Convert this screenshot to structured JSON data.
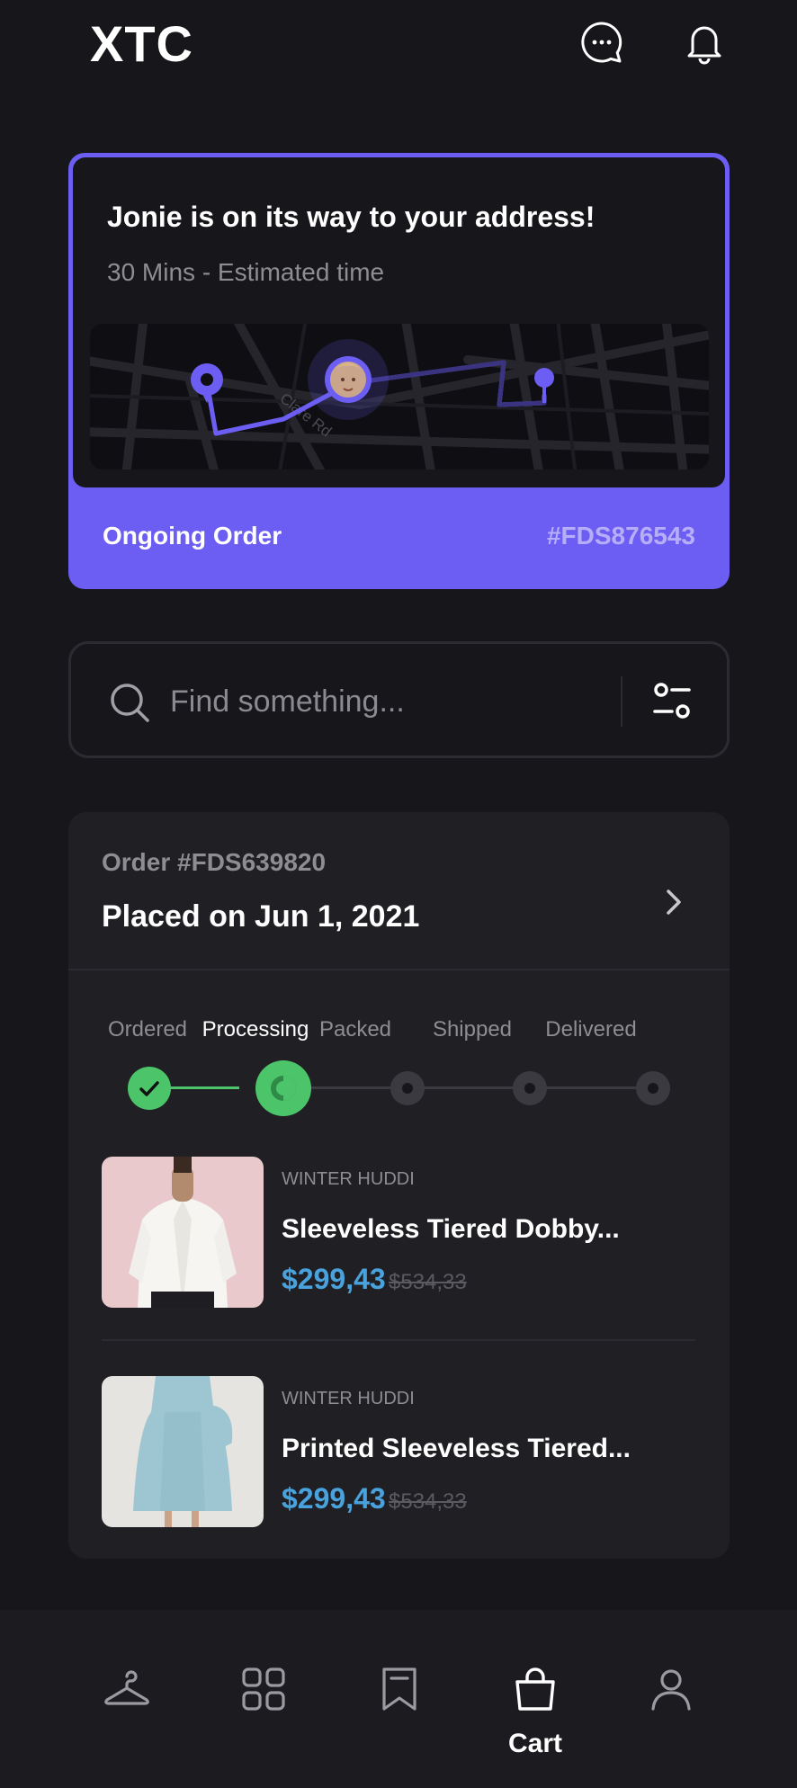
{
  "header": {
    "logo": "XTC",
    "icons": [
      "chat-icon",
      "bell-icon"
    ]
  },
  "tracking": {
    "title": "Jonie is on its way to your address!",
    "subtitle": "30 Mins - Estimated time",
    "map_street": "Clare Rd",
    "footer_label": "Ongoing Order",
    "order_code": "#FDS876543",
    "accent": "#6c5ef2"
  },
  "search": {
    "placeholder": "Find something..."
  },
  "order": {
    "number": "Order #FDS639820",
    "placed": "Placed on Jun 1, 2021",
    "steps": [
      {
        "label": "Ordered",
        "state": "done"
      },
      {
        "label": "Processing",
        "state": "active"
      },
      {
        "label": "Packed",
        "state": "pending"
      },
      {
        "label": "Shipped",
        "state": "pending"
      },
      {
        "label": "Delivered",
        "state": "pending"
      }
    ],
    "products": [
      {
        "category": "WINTER HUDDI",
        "name": "Sleeveless Tiered Dobby...",
        "price": "$299,43",
        "old_price": "$534,33"
      },
      {
        "category": "WINTER HUDDI",
        "name": "Printed Sleeveless Tiered...",
        "price": "$299,43",
        "old_price": "$534,33"
      }
    ]
  },
  "nav": {
    "items": [
      {
        "icon": "hanger-icon"
      },
      {
        "icon": "grid-icon"
      },
      {
        "icon": "bookmark-icon"
      },
      {
        "icon": "bag-icon",
        "label": "Cart",
        "active": true
      },
      {
        "icon": "user-icon"
      }
    ]
  },
  "colors": {
    "background": "#17171b",
    "accent": "#6c5ef2",
    "success": "#4cc46a",
    "price": "#4aa2dc"
  }
}
